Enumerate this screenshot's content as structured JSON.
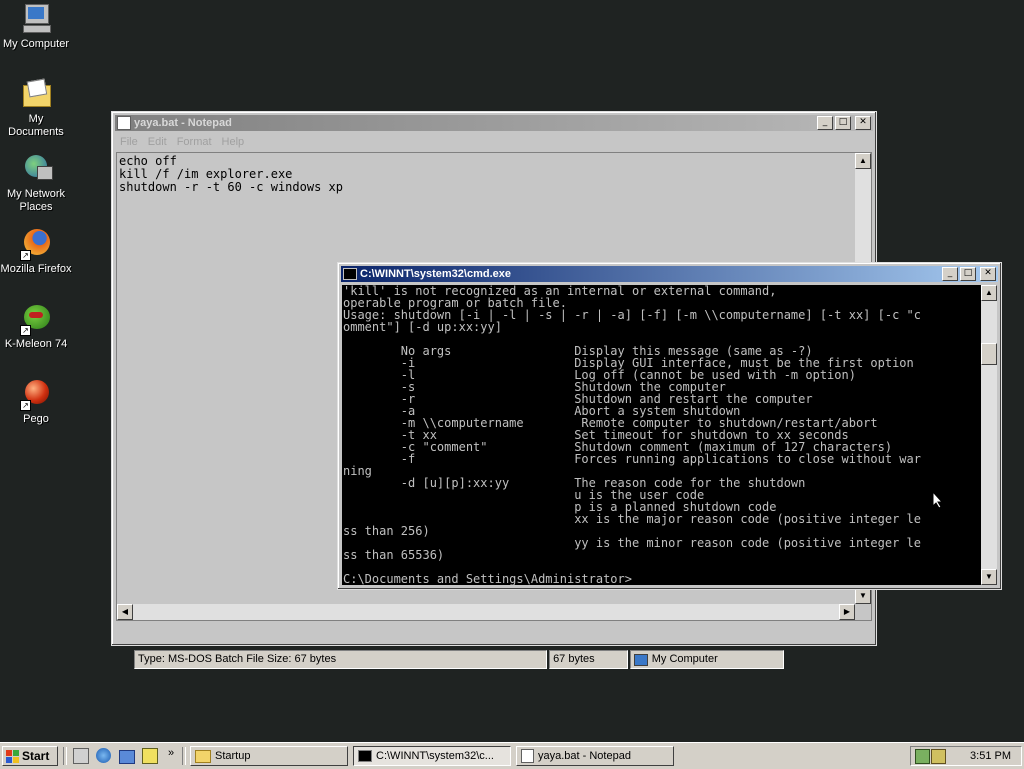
{
  "desktop": {
    "icons": [
      {
        "label": "My Computer",
        "icon": "my-computer-icon"
      },
      {
        "label": "My Documents",
        "icon": "my-documents-icon"
      },
      {
        "label": "My Network Places",
        "icon": "network-places-icon"
      },
      {
        "label": "Mozilla Firefox",
        "icon": "firefox-icon"
      },
      {
        "label": "K-Meleon 74",
        "icon": "k-meleon-icon"
      },
      {
        "label": "Pego",
        "icon": "pego-icon"
      }
    ]
  },
  "notepad": {
    "title": "yaya.bat - Notepad",
    "menu": [
      "File",
      "Edit",
      "Format",
      "Help"
    ],
    "content": "echo off\nkill /f /im explorer.exe\nshutdown -r -t 60 -c windows xp",
    "status": {
      "type_size": "Type: MS-DOS Batch File Size: 67 bytes",
      "size": "67 bytes",
      "location": "My Computer"
    }
  },
  "cmd": {
    "title": "C:\\WINNT\\system32\\cmd.exe",
    "output": "'kill' is not recognized as an internal or external command,\noperable program or batch file.\nUsage: shutdown [-i | -l | -s | -r | -a] [-f] [-m \\\\computername] [-t xx] [-c \"c\nomment\"] [-d up:xx:yy]\n\n        No args                 Display this message (same as -?)\n        -i                      Display GUI interface, must be the first option\n        -l                      Log off (cannot be used with -m option)\n        -s                      Shutdown the computer\n        -r                      Shutdown and restart the computer\n        -a                      Abort a system shutdown\n        -m \\\\computername        Remote computer to shutdown/restart/abort\n        -t xx                   Set timeout for shutdown to xx seconds\n        -c \"comment\"            Shutdown comment (maximum of 127 characters)\n        -f                      Forces running applications to close without war\nning\n        -d [u][p]:xx:yy         The reason code for the shutdown\n                                u is the user code\n                                p is a planned shutdown code\n                                xx is the major reason code (positive integer le\nss than 256)\n                                yy is the minor reason code (positive integer le\nss than 65536)\n\nC:\\Documents and Settings\\Administrator>"
  },
  "taskbar": {
    "start_label": "Start",
    "items": [
      {
        "label": "Startup"
      },
      {
        "label": "C:\\WINNT\\system32\\c..."
      },
      {
        "label": "yaya.bat - Notepad"
      }
    ],
    "quicklaunch_more": "»",
    "clock": "3:51 PM"
  },
  "colors": {
    "desktop": "#1f2322",
    "active_title": "#0a246a",
    "console_bg": "#000000",
    "console_fg": "#c0c0c0"
  }
}
